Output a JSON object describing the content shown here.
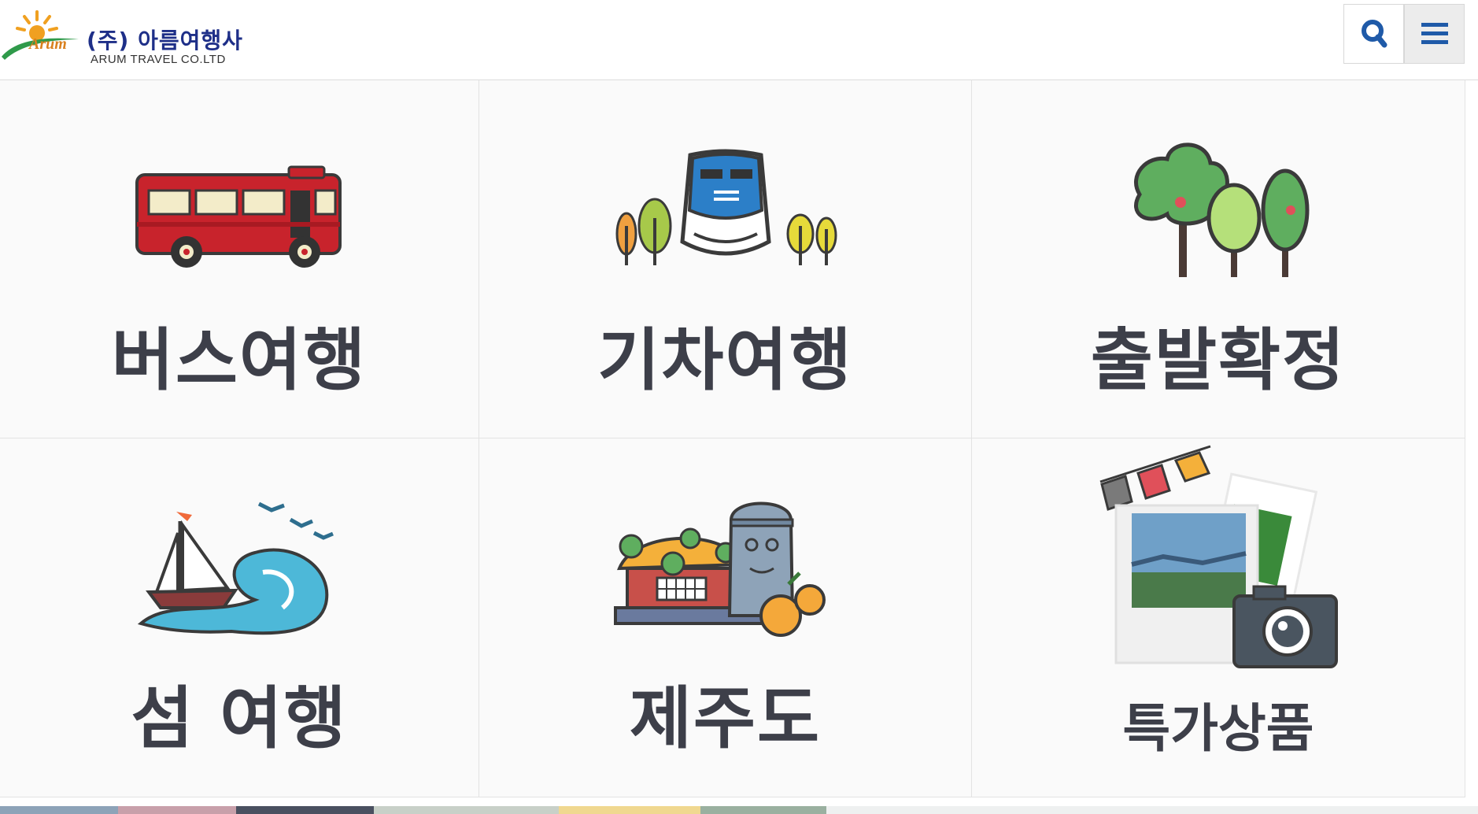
{
  "header": {
    "logo_mark": "Arum",
    "company_name": "(주) 아름여행사",
    "company_english": "ARUM TRAVEL CO.LTD",
    "buttons": [
      {
        "icon": "search-icon"
      },
      {
        "icon": "hamburger-menu-icon"
      }
    ]
  },
  "categories": [
    {
      "label": "버스여행",
      "icon": "bus-icon"
    },
    {
      "label": "기차여행",
      "icon": "train-icon"
    },
    {
      "label": "출발확정",
      "icon": "trees-icon"
    },
    {
      "label": "섬 여행",
      "icon": "sailboat-wave-icon"
    },
    {
      "label": "제주도",
      "icon": "jeju-stone-statue-icon"
    },
    {
      "label": "특가상품",
      "icon": "photos-camera-icon"
    }
  ],
  "colors": {
    "brand_navy": "#1e2f88",
    "label_text": "#3d3f49",
    "tile_bg": "#fafafa"
  }
}
